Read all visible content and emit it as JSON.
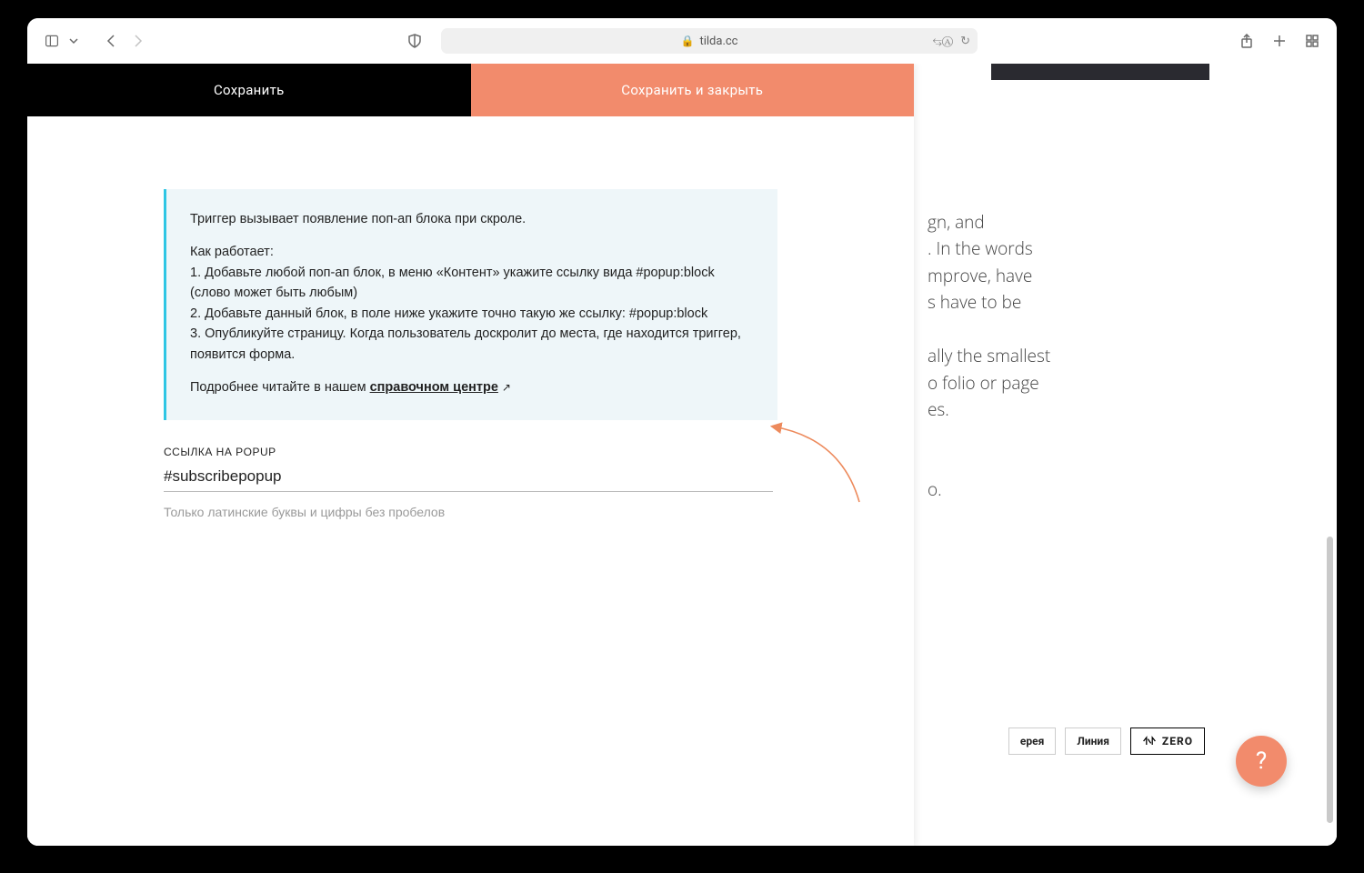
{
  "browser": {
    "url": "tilda.cc"
  },
  "panel": {
    "tabs": {
      "save": "Сохранить",
      "save_close": "Сохранить и закрыть"
    },
    "info": {
      "p1": "Триггер вызывает появление поп-ап блока при скроле.",
      "p2": "Как работает:",
      "p3": "1. Добавьте любой поп-ап блок, в меню «Контент» укажите ссылку вида #popup:block (слово может быть любым)",
      "p4": "2. Добавьте данный блок, в поле ниже укажите точно такую же ссылку: #popup:block",
      "p5": "3. Опубликуйте страницу. Когда пользователь доскролит до места, где находится триггер, появится форма.",
      "more_prefix": "Подробнее читайте в нашем ",
      "more_link": "справочном центре"
    },
    "field": {
      "label": "ССЫЛКА НА POPUP",
      "value": "#subscribepopup",
      "hint": "Только латинские буквы и цифры без пробелов"
    }
  },
  "bg": {
    "text_fragments": [
      "gn, and",
      ". In the words",
      "mprove, have",
      "s have to be",
      "",
      "ally the smallest",
      "o folio or page",
      "es.",
      "",
      "",
      "o."
    ],
    "buttons": {
      "gallery": "ерея",
      "line": "Линия",
      "zero": "ZERO"
    }
  },
  "help": "?"
}
